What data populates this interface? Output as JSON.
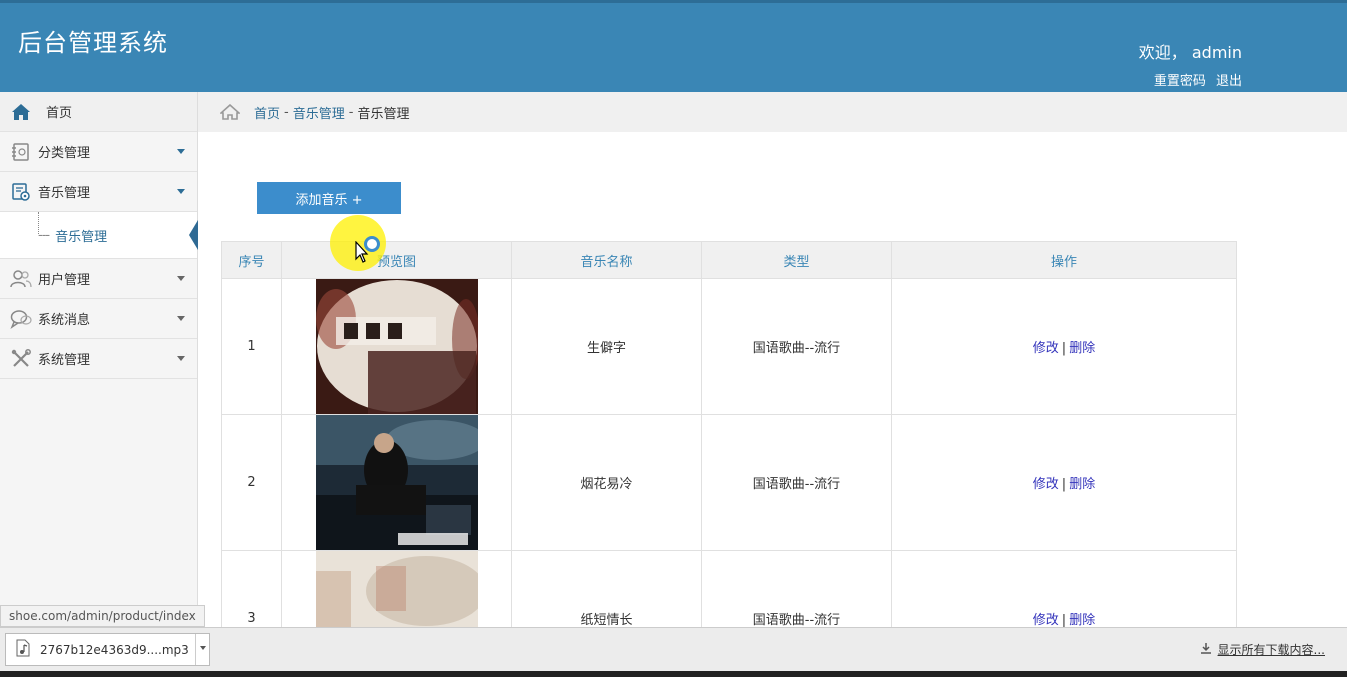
{
  "header": {
    "title": "后台管理系统",
    "welcome": "欢迎， admin",
    "reset_password": "重置密码",
    "logout": "退出"
  },
  "sidebar": {
    "home": "首页",
    "items": [
      {
        "label": "分类管理",
        "icon": "category-icon"
      },
      {
        "label": "音乐管理",
        "icon": "music-settings-icon",
        "expanded": true,
        "children": [
          {
            "label": "音乐管理",
            "active": true
          }
        ]
      },
      {
        "label": "用户管理",
        "icon": "users-icon"
      },
      {
        "label": "系统消息",
        "icon": "message-icon"
      },
      {
        "label": "系统管理",
        "icon": "tools-icon"
      }
    ]
  },
  "breadcrumb": {
    "home": "首页",
    "sep": "-",
    "section": "音乐管理",
    "current": "音乐管理"
  },
  "main": {
    "add_button": "添加音乐 +",
    "table": {
      "headers": [
        "序号",
        "预览图",
        "音乐名称",
        "类型",
        "操作"
      ],
      "rows": [
        {
          "index": "1",
          "name": "生僻字",
          "type": "国语歌曲--流行",
          "edit": "修改",
          "delete": "删除"
        },
        {
          "index": "2",
          "name": "烟花易冷",
          "type": "国语歌曲--流行",
          "edit": "修改",
          "delete": "删除"
        },
        {
          "index": "3",
          "name": "纸短情长",
          "type": "国语歌曲--流行",
          "edit": "修改",
          "delete": "删除"
        }
      ],
      "op_sep": "|"
    }
  },
  "status_bar": {
    "url": "shoe.com/admin/product/index"
  },
  "download_bar": {
    "file_name": "2767b12e4363d9....mp3",
    "show_all": "显示所有下载内容..."
  },
  "colors": {
    "header_bg": "#3a86b5",
    "link": "#2d6d96",
    "button": "#3c8dcc"
  }
}
